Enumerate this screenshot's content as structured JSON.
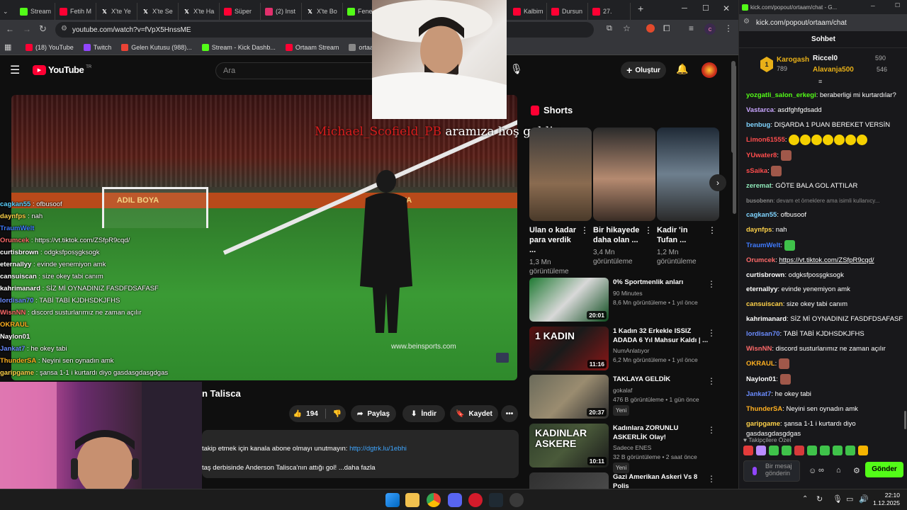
{
  "browser": {
    "tabs": [
      {
        "label": "Stream",
        "color": "#53fc18"
      },
      {
        "label": "Fetih M",
        "color": "#ff0033"
      },
      {
        "label": "X'te Ye",
        "color": "#ffffff"
      },
      {
        "label": "X'te Se",
        "color": "#ffffff"
      },
      {
        "label": "X'te Ha",
        "color": "#ffffff"
      },
      {
        "label": "Süper",
        "color": "#ff0033"
      },
      {
        "label": "(2) Inst",
        "color": "#e1306c"
      },
      {
        "label": "X'te Bo",
        "color": "#ffffff"
      },
      {
        "label": "Fene",
        "color": "#53fc18"
      },
      {
        "label": "Kalbim",
        "color": "#ff0033"
      },
      {
        "label": "Dursun",
        "color": "#ff0033"
      },
      {
        "label": "27.",
        "color": "#ff0033"
      }
    ],
    "url": "youtube.com/watch?v=fVpX5HnssME",
    "bookmarks": [
      {
        "label": "(18) YouTube",
        "color": "#ff0033"
      },
      {
        "label": "Twitch",
        "color": "#9146ff"
      },
      {
        "label": "Gelen Kutusu (988)...",
        "color": "#ea4335"
      },
      {
        "label": "Stream - Kick Dashb...",
        "color": "#53fc18"
      },
      {
        "label": "Ortaam Stream",
        "color": "#ff0033"
      },
      {
        "label": "ortaam - Kick Stats,...",
        "color": "#888888"
      }
    ]
  },
  "youtube": {
    "logo": "YouTube",
    "logo_sup": "TR",
    "search_placeholder": "Ara",
    "create_label": "Oluştur",
    "video_overlay_text_user": "Michael_Scofield_PB",
    "video_overlay_text_rest": "aramıza hoş geldin",
    "adboard_text": "ADIL BOYA",
    "watermark": "www.beinsports.com",
    "title_partial": "n Talisca",
    "actions": {
      "likes": "194",
      "share": "Paylaş",
      "download": "İndir",
      "save": "Kaydet"
    },
    "description": {
      "line1_prefix": "takip etmek için kanala abone olmayı unutmayın: ",
      "line1_link": "http://dgtrk.lu/1ebhi",
      "line2": "taş derbisinde Anderson Talisca'nın attığı gol! ...daha fazla"
    },
    "shorts_label": "Shorts",
    "shorts": [
      {
        "title": "Ulan o kadar para verdik ...",
        "views": "1,3 Mn görüntüleme"
      },
      {
        "title": "Bir hikayede daha olan ...",
        "views": "3,4 Mn görüntüleme"
      },
      {
        "title": "Kadir 'in Tufan ...",
        "views": "1,2 Mn görüntüleme"
      }
    ],
    "videos": [
      {
        "title": "0% Sportmenlik anları",
        "channel": "90 Minutes",
        "meta": "8,6 Mn görüntüleme • 1 yıl önce",
        "duration": "20:01",
        "badge": ""
      },
      {
        "title": "1 Kadın 32 Erkekle ISSIZ ADADA 6 Yıl Mahsur Kaldı | ...",
        "channel": "NumAnlatıyor",
        "meta": "6,2 Mn görüntüleme • 1 yıl önce",
        "duration": "11:16",
        "badge": "",
        "thumb_text": "1 KADIN"
      },
      {
        "title": "TAKLAYA GELDİK",
        "channel": "gokalaf",
        "meta": "476 B görüntüleme • 1 gün önce",
        "duration": "20:37",
        "badge": "Yeni"
      },
      {
        "title": "Kadınlara ZORUNLU ASKERLİK Olay!",
        "channel": "Sadece ENES",
        "meta": "32 B görüntüleme • 2 saat önce",
        "duration": "10:11",
        "badge": "Yeni",
        "thumb_text": "KADINLAR ASKERE"
      },
      {
        "title": "Gazi Amerikan Askeri Vs 8 Polis",
        "channel": "",
        "meta": "",
        "duration": "",
        "badge": ""
      }
    ]
  },
  "overlay_chat": [
    {
      "user": "cagkan55",
      "msg": "ofbusoof",
      "color": "#5ad1ff"
    },
    {
      "user": "daynfps",
      "msg": "nah",
      "color": "#ffd24a"
    },
    {
      "user": "TraumWelt",
      "msg": "",
      "color": "#3f7bff"
    },
    {
      "user": "Orumcek",
      "msg": "https://vt.tiktok.com/ZSfpR9cqd/",
      "color": "#ff6a6a"
    },
    {
      "user": "curtisbrown",
      "msg": "odgksfposşgksogk",
      "color": "#ffffff"
    },
    {
      "user": "eternallyy",
      "msg": "evinde yenemiyon amk",
      "color": "#ffffff"
    },
    {
      "user": "cansuiscan",
      "msg": "size okey tabi canım",
      "color": "#ffffff"
    },
    {
      "user": "kahrimanard",
      "msg": "SİZ Mİ OYNADINIZ FASDFDSAFASF",
      "color": "#ffffff"
    },
    {
      "user": "lordisan70",
      "msg": "TABİ TABİ KJDHSDKJFHS",
      "color": "#6b8cff"
    },
    {
      "user": "WisnNN",
      "msg": "discord susturlarımız ne zaman açılır",
      "color": "#ff6a6a"
    },
    {
      "user": "OKRAUL",
      "msg": "",
      "color": "#ffb020"
    },
    {
      "user": "Naylon01",
      "msg": "",
      "color": "#ffffff"
    },
    {
      "user": "Jankat7",
      "msg": "he okey tabi",
      "color": "#6b8cff"
    },
    {
      "user": "ThunderSA",
      "msg": "Neyini sen oynadın amk",
      "color": "#ffb020"
    },
    {
      "user": "garipgame",
      "msg": "şansa 1-1 i kurtardı diyo gasdasgdasgdgas",
      "color": "#ffd24a"
    }
  ],
  "kick_chat": {
    "window_title": "kick.com/popout/ortaam/chat - G...",
    "url": "kick.com/popout/ortaam/chat",
    "header": "Sohbet",
    "leaders": [
      {
        "name": "Karogash",
        "value": "789"
      },
      {
        "name": "Riccel0",
        "value": "590"
      },
      {
        "name": "Alavanja500",
        "value": "546"
      }
    ],
    "messages": [
      {
        "user": "yozgatli_salon_erkegi",
        "msg": "beraberligi mi kurtardılar?",
        "color": "#53fc18"
      },
      {
        "user": "Vastarca",
        "msg": "asdfghfgdsadd",
        "color": "#c9a6ff"
      },
      {
        "user": "benbug",
        "msg": "DIŞARDA 1 PUAN BEREKET VERSİN",
        "color": "#7fd4ff"
      },
      {
        "user": "Limon61555",
        "msg": "",
        "color": "#ff4d4d"
      },
      {
        "user": "YUwater8",
        "msg": "",
        "color": "#ff4d4d"
      },
      {
        "user": "sSaika",
        "msg": "",
        "color": "#ff4d4d"
      },
      {
        "user": "zeremat",
        "msg": "GÖTE BALA GOL ATTILAR",
        "color": "#8ee8b8"
      },
      {
        "user": "busobenn",
        "msg": "devam et örneklere ama isimli kullanıcy...",
        "color": "#888888"
      },
      {
        "user": "cagkan55",
        "msg": "ofbusoof",
        "color": "#7fd4ff"
      },
      {
        "user": "daynfps",
        "msg": "nah",
        "color": "#ffd24a"
      },
      {
        "user": "TraumWelt",
        "msg": "",
        "color": "#3f7bff"
      },
      {
        "user": "Orumcek",
        "msg": "https://vt.tiktok.com/ZSfpR9cqd/",
        "color": "#ff6a6a"
      },
      {
        "user": "curtisbrown",
        "msg": "odgksfposşgksogk",
        "color": "#ffffff"
      },
      {
        "user": "eternallyy",
        "msg": "evinde yenemiyon amk",
        "color": "#ffffff"
      },
      {
        "user": "cansuiscan",
        "msg": "size okey tabi canım",
        "color": "#ffd24a"
      },
      {
        "user": "kahrimanard",
        "msg": "SİZ Mİ OYNADINIZ FASDFDSAFASF",
        "color": "#ffffff"
      },
      {
        "user": "lordisan70",
        "msg": "TABİ TABİ KJDHSDKJFHS",
        "color": "#6b8cff"
      },
      {
        "user": "WisnNN",
        "msg": "discord susturlarımız ne zaman açılır",
        "color": "#ff6a6a"
      },
      {
        "user": "OKRAUL",
        "msg": "",
        "color": "#ffb020"
      },
      {
        "user": "Naylon01",
        "msg": "",
        "color": "#ffffff"
      },
      {
        "user": "Jankat7",
        "msg": "he okey tabi",
        "color": "#6b8cff"
      },
      {
        "user": "ThunderSA",
        "msg": "Neyini sen oynadın amk",
        "color": "#ffb020"
      },
      {
        "user": "garipgame",
        "msg": "şansa 1-1 i kurtardı diyo gasdasgdasgdgas",
        "color": "#ffd24a"
      }
    ],
    "followers_label": "Takipçilere Özel",
    "input_placeholder": "Bir mesaj gönderin",
    "send_label": "Gönder"
  },
  "taskbar": {
    "time": "22:10",
    "date": "1.12.2025"
  },
  "colors": {
    "kick_green": "#53fc18",
    "youtube_red": "#ff0033",
    "link_blue": "#3ea6ff"
  }
}
